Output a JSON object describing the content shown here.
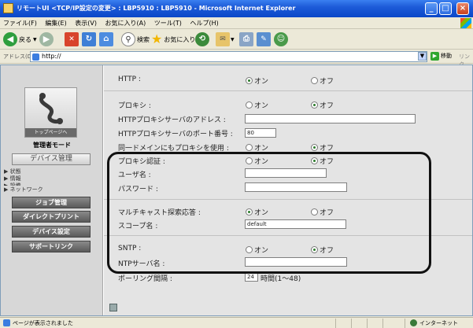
{
  "window": {
    "title": "リモートUI <TCP/IP設定の変更> : LBP5910 : LBP5910 - Microsoft Internet Explorer",
    "controls": [
      "_",
      "□",
      "×"
    ]
  },
  "menu": [
    "ファイル(F)",
    "編集(E)",
    "表示(V)",
    "お気に入り(A)",
    "ツール(T)",
    "ヘルプ(H)"
  ],
  "toolbar": {
    "back": "戻る",
    "search": "検索",
    "favorites": "お気に入り"
  },
  "address": {
    "label": "アドレス(D)",
    "value": "http://",
    "go": "移動",
    "links": "リンク"
  },
  "sidebar": {
    "logo_caption": "トップページへ",
    "mode": "管理者モード",
    "device_button": "デバイス管理",
    "subitems": [
      "▶ 状態",
      "▶ 情報",
      "▶ 設備",
      "▶ ネットワーク"
    ],
    "nav": [
      "ジョブ管理",
      "ダイレクトプリント",
      "デバイス設定",
      "サポートリンク"
    ]
  },
  "form": {
    "on": "オン",
    "off": "オフ",
    "http": {
      "label": "HTTP :",
      "value": "on"
    },
    "proxy": {
      "label": "プロキシ :",
      "value": "off"
    },
    "proxy_address": {
      "label": "HTTPプロキシサーバのアドレス :",
      "value": ""
    },
    "proxy_port": {
      "label": "HTTPプロキシサーバのポート番号 :",
      "value": "80"
    },
    "same_domain": {
      "label": "同一ドメインにもプロキシを使用 :",
      "value": "off"
    },
    "proxy_auth": {
      "label": "プロキシ認証 :",
      "value": "off"
    },
    "username": {
      "label": "ユーザ名 :",
      "value": ""
    },
    "password": {
      "label": "パスワード :",
      "value": ""
    },
    "multicast": {
      "label": "マルチキャスト探索応答 :",
      "value": "on"
    },
    "scope": {
      "label": "スコープ名 :",
      "value": "default"
    },
    "sntp": {
      "label": "SNTP :",
      "value": "off"
    },
    "ntp_server": {
      "label": "NTPサーバ名 :",
      "value": ""
    },
    "polling": {
      "label": "ポーリング間隔 :",
      "value": "24",
      "unit": "時間(1〜48)"
    }
  },
  "status": {
    "left": "ページが表示されました",
    "zone": "インターネット"
  }
}
